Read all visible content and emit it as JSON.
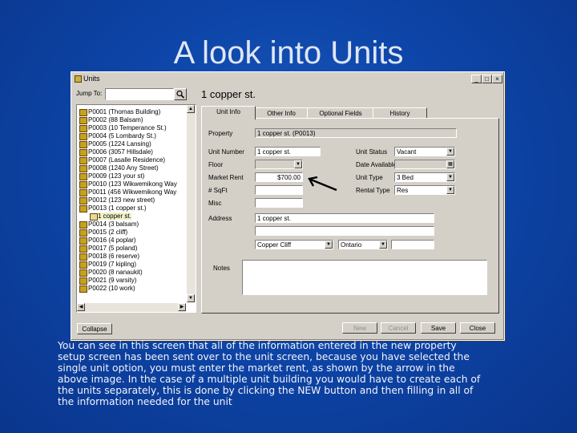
{
  "slide": {
    "title": "A look into Units",
    "caption_lines": [
      "You can see in this screen that all of the information entered in the new property",
      "setup screen has been sent over to the unit screen, because you have selected the",
      "single unit option, you must enter the market rent, as shown by the arrow in the",
      "above image. In the case of a multiple unit building you would have to create each of",
      "the units separately, this is done by clicking the NEW button and then filling in all of",
      "the information needed for the unit"
    ]
  },
  "window": {
    "title": "Units",
    "controls": {
      "minimize": "_",
      "maximize": "□",
      "close": "×"
    },
    "jump_label": "Jump To:",
    "jump_value": "",
    "selected_unit": "1 copper st."
  },
  "tree": [
    {
      "label": "P0001 (Thomas Building)",
      "child": false
    },
    {
      "label": "P0002 (88 Balsam)",
      "child": false
    },
    {
      "label": "P0003 (10 Temperance St.)",
      "child": false
    },
    {
      "label": "P0004 (5 Lombardy St.)",
      "child": false
    },
    {
      "label": "P0005 (1224 Lansing)",
      "child": false
    },
    {
      "label": "P0006 (3057 Hillsdale)",
      "child": false
    },
    {
      "label": "P0007 (Lasalle Residence)",
      "child": false
    },
    {
      "label": "P0008 (1240 Any Street)",
      "child": false
    },
    {
      "label": "P0009 (123 your st)",
      "child": false
    },
    {
      "label": "P0010 (123 Wikwemikong Way",
      "child": false
    },
    {
      "label": "P0011 (456 Wikwemikong Way",
      "child": false
    },
    {
      "label": "P0012 (123 new street)",
      "child": false
    },
    {
      "label": "P0013 (1 copper st.)",
      "child": false
    },
    {
      "label": "1 copper st.",
      "child": true
    },
    {
      "label": "P0014 (3 balsam)",
      "child": false
    },
    {
      "label": "P0015 (2 cliff)",
      "child": false
    },
    {
      "label": "P0016 (4 poplar)",
      "child": false
    },
    {
      "label": "P0017 (5 poland)",
      "child": false
    },
    {
      "label": "P0018 (6 reserve)",
      "child": false
    },
    {
      "label": "P0019 (7 kipling)",
      "child": false
    },
    {
      "label": "P0020 (8 nanaukit)",
      "child": false
    },
    {
      "label": "P0021 (9 varsity)",
      "child": false
    },
    {
      "label": "P0022 (10 work)",
      "child": false
    }
  ],
  "tabs": [
    "Unit Info",
    "Other Info",
    "Optional Fields",
    "History"
  ],
  "form": {
    "property_label": "Property",
    "property_value": "1 copper st. (P0013)",
    "unit_number_label": "Unit Number",
    "unit_number_value": "1 copper st.",
    "floor_label": "Floor",
    "floor_value": "",
    "market_rent_label": "Market Rent",
    "market_rent_value": "$700.00",
    "sq_feet_label": "# SqFt",
    "sq_feet_value": "",
    "misc_label": "Misc",
    "misc_value": "",
    "unit_status_label": "Unit Status",
    "unit_status_value": "Vacant",
    "date_available_label": "Date Available",
    "date_available_value": "",
    "unit_type_label": "Unit Type",
    "unit_type_value": "3 Bed",
    "rental_type_label": "Rental Type",
    "rental_type_value": "Res",
    "address_label": "Address",
    "address_line1": "1 copper st.",
    "address_line2": "",
    "city_value": "Copper Cliff",
    "province_value": "Ontario",
    "postal_value": "",
    "notes_label": "Notes",
    "notes_value": ""
  },
  "buttons": {
    "collapse": "Collapse",
    "new": "New",
    "cancel": "Cancel",
    "save": "Save",
    "close": "Close"
  }
}
